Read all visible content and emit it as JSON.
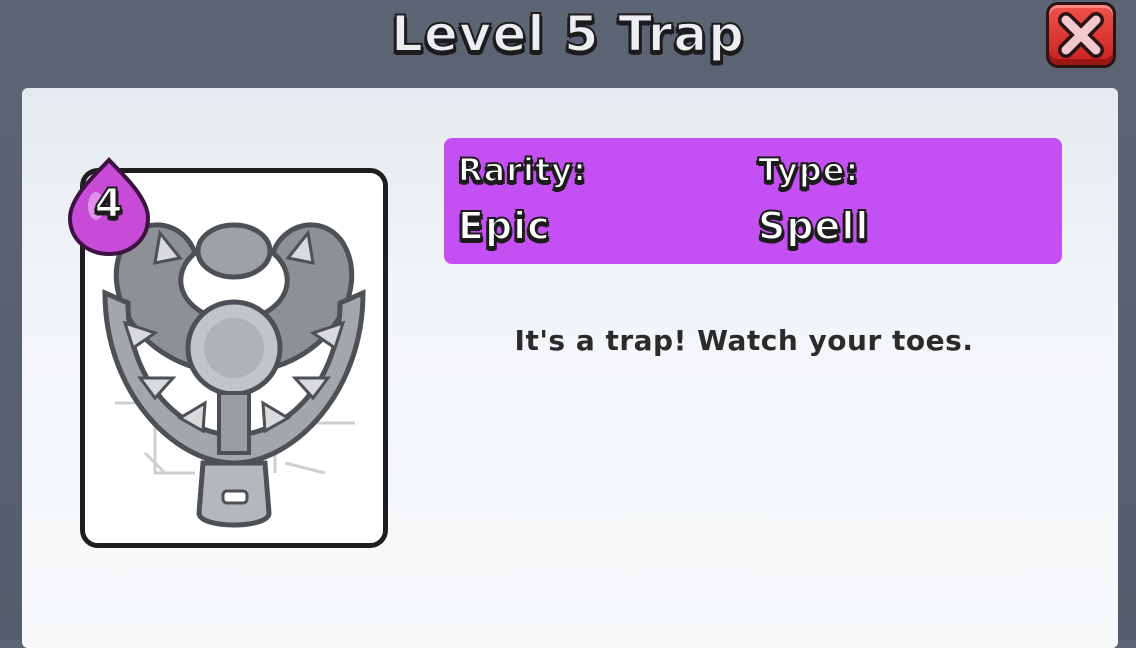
{
  "header": {
    "title": "Level 5 Trap",
    "close_icon": "close-x-icon"
  },
  "card": {
    "elixir_cost": "4",
    "elixir_icon": "elixir-drop-icon",
    "art_icon": "trap-art-icon"
  },
  "info": {
    "rarity_label": "Rarity:",
    "rarity_value": "Epic",
    "type_label": "Type:",
    "type_value": "Spell"
  },
  "description": "It's a trap! Watch your toes.",
  "colors": {
    "info_box": "#c44ff2",
    "close_button": "#e23a36",
    "panel": "#f3f6f9",
    "elixir": "#c84bd8"
  }
}
